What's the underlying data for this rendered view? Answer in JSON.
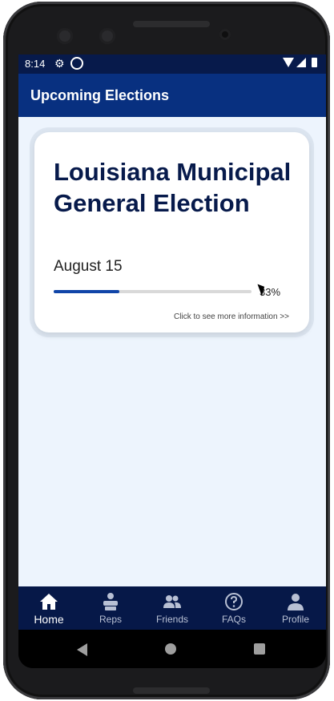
{
  "status_bar": {
    "time": "8:14",
    "icons": [
      "gear-icon",
      "sync-icon",
      "wifi-icon",
      "signal-icon",
      "battery-icon"
    ]
  },
  "app_bar": {
    "title": "Upcoming Elections"
  },
  "election_card": {
    "title": "Louisiana Municipal General Election",
    "date": "August 15",
    "progress_percent": 33,
    "progress_label": "33%",
    "link_text": "Click to see more information >>"
  },
  "bottom_nav": {
    "items": [
      {
        "label": "Home",
        "icon": "home-icon",
        "active": true
      },
      {
        "label": "Reps",
        "icon": "reps-icon",
        "active": false
      },
      {
        "label": "Friends",
        "icon": "friends-icon",
        "active": false
      },
      {
        "label": "FAQs",
        "icon": "help-icon",
        "active": false
      },
      {
        "label": "Profile",
        "icon": "person-icon",
        "active": false
      }
    ]
  },
  "colors": {
    "status_bar": "#071a4b",
    "app_bar": "#083080",
    "content_bg": "#edf4fd",
    "title_text": "#071a4b",
    "progress_fill": "#1045a8",
    "bottom_nav": "#061848"
  }
}
